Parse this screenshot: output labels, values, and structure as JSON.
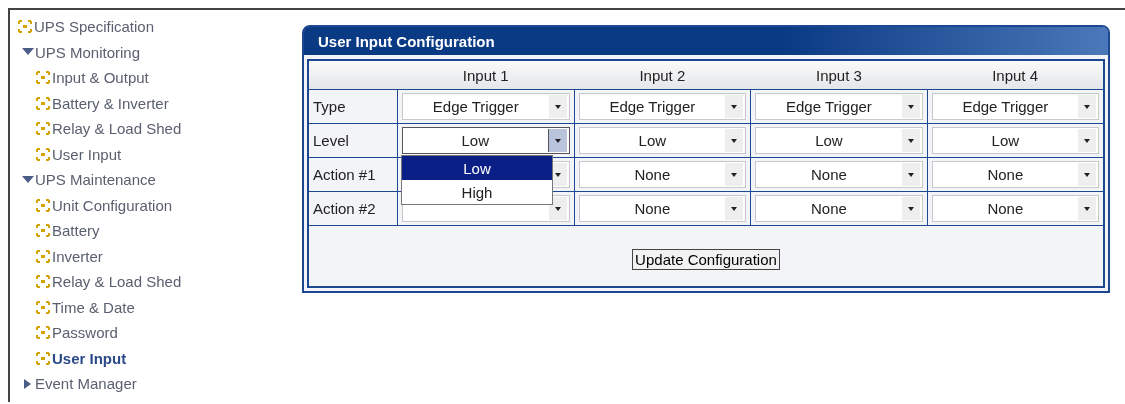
{
  "sidebar": {
    "items": [
      {
        "kind": "page",
        "label": "UPS Specification",
        "selected": false
      },
      {
        "kind": "section",
        "label": "UPS Monitoring",
        "expanded": true,
        "children": [
          {
            "kind": "page",
            "label": "Input & Output",
            "selected": false
          },
          {
            "kind": "page",
            "label": "Battery & Inverter",
            "selected": false
          },
          {
            "kind": "page",
            "label": "Relay & Load Shed",
            "selected": false
          },
          {
            "kind": "page",
            "label": "User Input",
            "selected": false
          }
        ]
      },
      {
        "kind": "section",
        "label": "UPS Maintenance",
        "expanded": true,
        "children": [
          {
            "kind": "page",
            "label": "Unit Configuration",
            "selected": false
          },
          {
            "kind": "page",
            "label": "Battery",
            "selected": false
          },
          {
            "kind": "page",
            "label": "Inverter",
            "selected": false
          },
          {
            "kind": "page",
            "label": "Relay & Load Shed",
            "selected": false
          },
          {
            "kind": "page",
            "label": "Time & Date",
            "selected": false
          },
          {
            "kind": "page",
            "label": "Password",
            "selected": false
          },
          {
            "kind": "page",
            "label": "User Input",
            "selected": true
          }
        ]
      },
      {
        "kind": "section",
        "label": "Event Manager",
        "expanded": false
      }
    ]
  },
  "panel": {
    "title": "User Input Configuration",
    "table": {
      "columns": [
        "Input 1",
        "Input 2",
        "Input 3",
        "Input 4"
      ],
      "rows": [
        {
          "label": "Type",
          "cells": [
            {
              "value": "Edge Trigger",
              "open": false
            },
            {
              "value": "Edge Trigger",
              "open": false
            },
            {
              "value": "Edge Trigger",
              "open": false
            },
            {
              "value": "Edge Trigger",
              "open": false
            }
          ]
        },
        {
          "label": "Level",
          "cells": [
            {
              "value": "Low",
              "open": true,
              "options": [
                {
                  "label": "Low",
                  "selected": true
                },
                {
                  "label": "High",
                  "selected": false
                }
              ]
            },
            {
              "value": "Low",
              "open": false
            },
            {
              "value": "Low",
              "open": false
            },
            {
              "value": "Low",
              "open": false
            }
          ]
        },
        {
          "label": "Action #1",
          "cells": [
            {
              "open": false
            },
            {
              "value": "None",
              "open": false
            },
            {
              "value": "None",
              "open": false
            },
            {
              "value": "None",
              "open": false
            }
          ]
        },
        {
          "label": "Action #2",
          "cells": [
            {
              "open": false
            },
            {
              "value": "None",
              "open": false
            },
            {
              "value": "None",
              "open": false
            },
            {
              "value": "None",
              "open": false
            }
          ]
        }
      ]
    },
    "button": "Update Configuration"
  }
}
